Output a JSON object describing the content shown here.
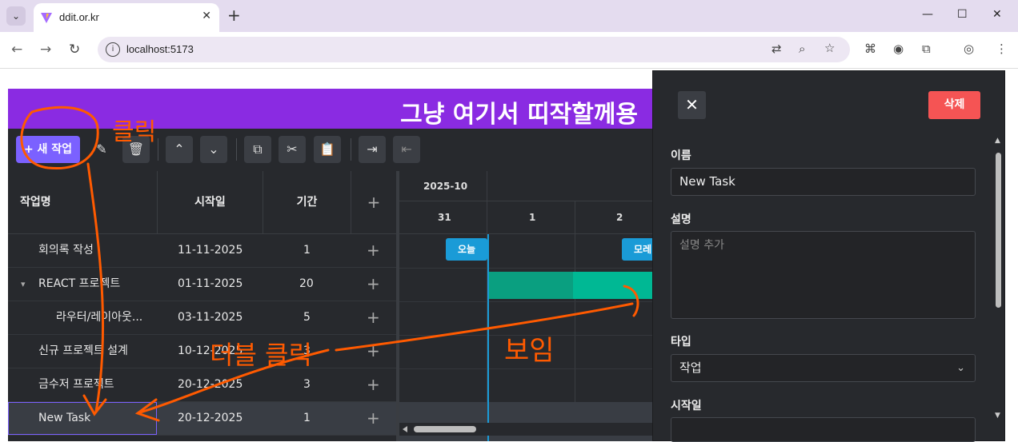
{
  "browser": {
    "tab_title": "ddit.or.kr",
    "url": "localhost:5173"
  },
  "app": {
    "banner": "그냥 여기서 띠작할께용",
    "new_task_button": "+ 새 작업"
  },
  "grid": {
    "headers": {
      "name": "작업명",
      "start": "시작일",
      "duration": "기간",
      "add": "+"
    },
    "rows": [
      {
        "name": "회의록 작성",
        "start": "11-11-2025",
        "duration": "1",
        "add": "+",
        "indent": 0,
        "expander": ""
      },
      {
        "name": "REACT 프로젝트",
        "start": "01-11-2025",
        "duration": "20",
        "add": "+",
        "indent": 0,
        "expander": "▾"
      },
      {
        "name": "라우터/레이아웃...",
        "start": "03-11-2025",
        "duration": "5",
        "add": "+",
        "indent": 1,
        "expander": ""
      },
      {
        "name": "신규 프로젝트 설계",
        "start": "10-12-2025",
        "duration": "3",
        "add": "+",
        "indent": 0,
        "expander": ""
      },
      {
        "name": "금수저 프로젝트",
        "start": "20-12-2025",
        "duration": "3",
        "add": "+",
        "indent": 0,
        "expander": ""
      },
      {
        "name": "New Task",
        "start": "20-12-2025",
        "duration": "1",
        "add": "+",
        "indent": 0,
        "expander": ""
      }
    ]
  },
  "chart": {
    "month": "2025-10",
    "days": [
      "31",
      "1",
      "2"
    ],
    "today_marker": "오늘",
    "dayafter_marker": "모레"
  },
  "panel": {
    "close": "✕",
    "delete": "삭제",
    "name_label": "이름",
    "name_value": "New Task",
    "desc_label": "설명",
    "desc_placeholder": "설명 추가",
    "type_label": "타입",
    "type_value": "작업",
    "start_label": "시작일"
  },
  "annotations": {
    "click": "클릭",
    "double_click": "더블 클릭",
    "shown": "보임"
  },
  "colors": {
    "banner": "#8a2be2",
    "primary": "#7b61ff",
    "bar": "#00b894",
    "today": "#1a9bd7",
    "delete": "#f55454",
    "annotation": "#ff5a00"
  }
}
